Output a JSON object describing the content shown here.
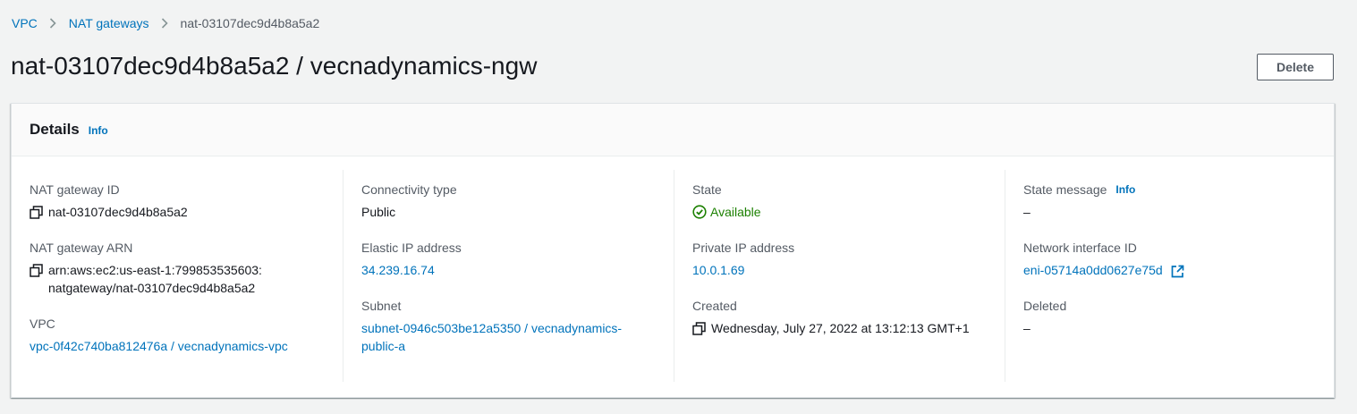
{
  "breadcrumb": {
    "items": [
      "VPC",
      "NAT gateways"
    ],
    "current": "nat-03107dec9d4b8a5a2"
  },
  "page": {
    "title": "nat-03107dec9d4b8a5a2 / vecnadynamics-ngw",
    "delete_label": "Delete"
  },
  "details": {
    "title": "Details",
    "info_label": "Info",
    "nat_gateway_id": {
      "label": "NAT gateway ID",
      "value": "nat-03107dec9d4b8a5a2"
    },
    "nat_gateway_arn": {
      "label": "NAT gateway ARN",
      "value": "arn:aws:ec2:us-east-1:799853535603:natgateway/nat-03107dec9d4b8a5a2"
    },
    "vpc": {
      "label": "VPC",
      "value": "vpc-0f42c740ba812476a / vecnadynamics-vpc"
    },
    "connectivity_type": {
      "label": "Connectivity type",
      "value": "Public"
    },
    "elastic_ip": {
      "label": "Elastic IP address",
      "value": "34.239.16.74"
    },
    "subnet": {
      "label": "Subnet",
      "value": "subnet-0946c503be12a5350 / vecnadynamics-public-a"
    },
    "state": {
      "label": "State",
      "value": "Available"
    },
    "private_ip": {
      "label": "Private IP address",
      "value": "10.0.1.69"
    },
    "created": {
      "label": "Created",
      "value": "Wednesday, July 27, 2022 at 13:12:13 GMT+1"
    },
    "state_message": {
      "label": "State message",
      "info_label": "Info",
      "value": "–"
    },
    "network_interface": {
      "label": "Network interface ID",
      "value": "eni-05714a0dd0627e75d"
    },
    "deleted": {
      "label": "Deleted",
      "value": "–"
    }
  },
  "icons": {
    "chevron": "chevron-right-icon",
    "copy": "copy-icon",
    "status": "status-available-icon",
    "external": "external-link-icon"
  },
  "colors": {
    "link": "#0073bb",
    "success": "#1d8102",
    "text": "#16191f",
    "muted": "#545b64",
    "background": "#f2f3f3"
  }
}
